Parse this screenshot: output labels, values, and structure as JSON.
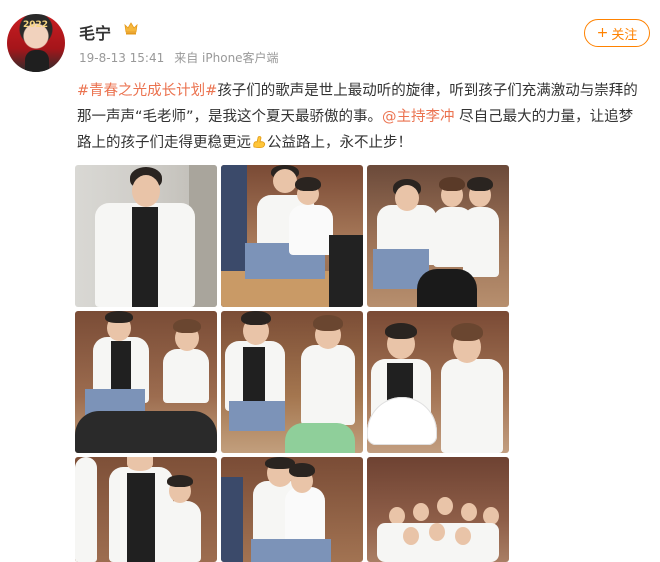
{
  "post": {
    "username": "毛宁",
    "avatar_year": "2022",
    "timestamp": "19-8-13 15:41",
    "source": "来自 iPhone客户端",
    "follow_label": "关注",
    "text": {
      "hashtag": "#青春之光成长计划#",
      "part1": "孩子们的歌声是世上最动听的旋律，听到孩子们充满激动与崇拜的那一声声“毛老师”，是我这个夏天最骄傲的事。",
      "mention": "@主持李冲",
      "part2": "尽自己最大的力量，让追梦路上的孩子们走得更稳更远",
      "part3": "公益路上，永不止步！"
    },
    "icons": {
      "badge": "vip-badge-icon",
      "strength": "muscle-emoji-icon"
    },
    "colors": {
      "accent": "#ff8200",
      "link": "#eb7350",
      "meta": "#999999"
    }
  }
}
